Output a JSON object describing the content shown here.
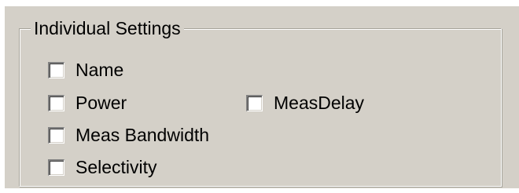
{
  "group": {
    "title": "Individual Settings",
    "options": {
      "name": {
        "label": "Name",
        "checked": false
      },
      "power": {
        "label": "Power",
        "checked": false
      },
      "meas_delay": {
        "label": "MeasDelay",
        "checked": false
      },
      "meas_bandwidth": {
        "label": "Meas Bandwidth",
        "checked": false
      },
      "selectivity": {
        "label": "Selectivity",
        "checked": false
      }
    }
  }
}
